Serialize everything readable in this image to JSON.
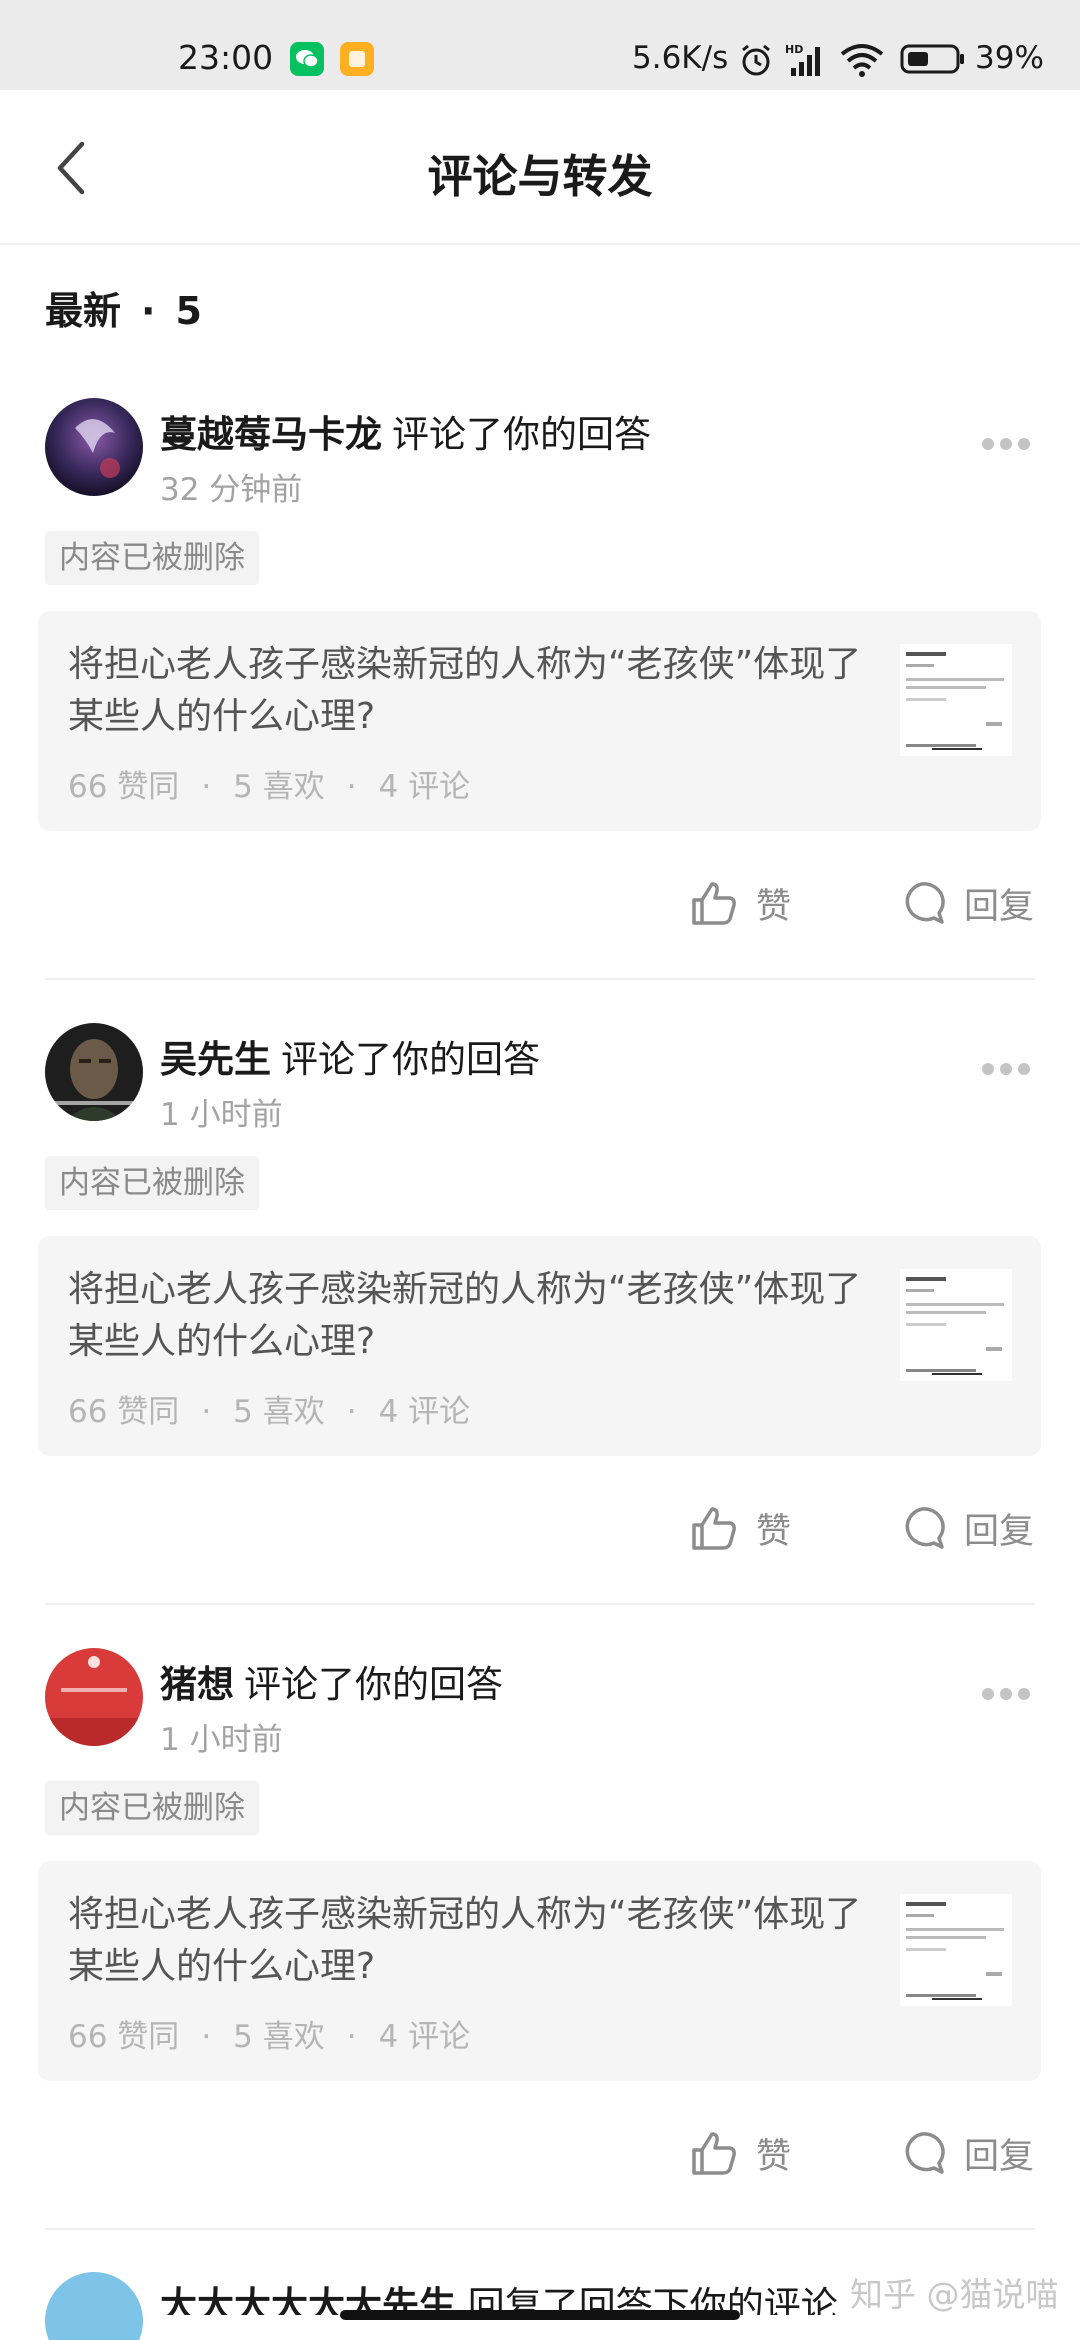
{
  "status_bar": {
    "time": "23:00",
    "network_speed": "5.6K/s",
    "battery_percent": "39%",
    "icons": [
      "wechat-icon",
      "app-notification-icon",
      "alarm-icon",
      "signal-hd-icon",
      "wifi-icon",
      "battery-icon"
    ],
    "colors": {
      "wechat": "#07c160",
      "app": "#ffb020"
    }
  },
  "header": {
    "title": "评论与转发",
    "back_icon": "chevron-left-icon"
  },
  "section": {
    "label": "最新",
    "separator": "·",
    "count": "5"
  },
  "notifications": [
    {
      "user": "蔓越莓马卡龙",
      "action": "评论了你的回答",
      "time": "32 分钟前",
      "tag": "内容已被删除",
      "card": {
        "title": "将担心老人孩子感染新冠的人称为“老孩侠”体现了某些人的什么心理?",
        "agree": "66 赞同",
        "like": "5 喜欢",
        "comments": "4 评论",
        "sep": "·"
      },
      "like_label": "赞",
      "reply_label": "回复"
    },
    {
      "user": "吴先生",
      "action": "评论了你的回答",
      "time": "1 小时前",
      "tag": "内容已被删除",
      "card": {
        "title": "将担心老人孩子感染新冠的人称为“老孩侠”体现了某些人的什么心理?",
        "agree": "66 赞同",
        "like": "5 喜欢",
        "comments": "4 评论",
        "sep": "·"
      },
      "like_label": "赞",
      "reply_label": "回复"
    },
    {
      "user": "猪想",
      "action": "评论了你的回答",
      "time": "1 小时前",
      "tag": "内容已被删除",
      "card": {
        "title": "将担心老人孩子感染新冠的人称为“老孩侠”体现了某些人的什么心理?",
        "agree": "66 赞同",
        "like": "5 喜欢",
        "comments": "4 评论",
        "sep": "·"
      },
      "like_label": "赞",
      "reply_label": "回复"
    }
  ],
  "peek": {
    "user": "大大大大大大先生",
    "action": "回复了回答下你的评论"
  },
  "watermark": "知乎 @猫说喵"
}
